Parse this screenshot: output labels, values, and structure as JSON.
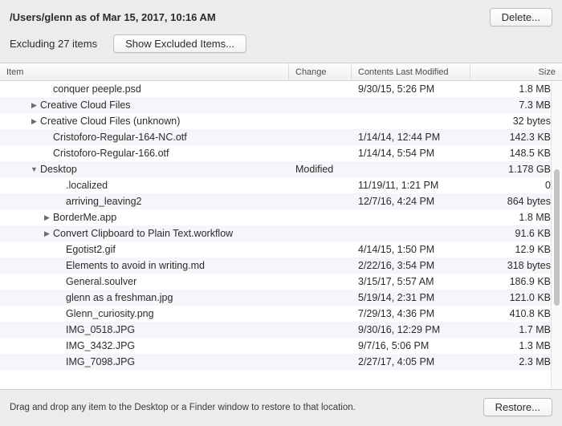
{
  "header": {
    "path_title": "/Users/glenn as of Mar 15, 2017, 10:16 AM",
    "delete_label": "Delete..."
  },
  "subheader": {
    "excluding_text": "Excluding 27 items",
    "show_excluded_label": "Show Excluded Items..."
  },
  "columns": {
    "item": "Item",
    "change": "Change",
    "modified": "Contents Last Modified",
    "size": "Size"
  },
  "rows": [
    {
      "indent": 2,
      "arrow": "",
      "name": "conquer peeple.psd",
      "change": "",
      "modified": "9/30/15, 5:26 PM",
      "size": "1.8 MB"
    },
    {
      "indent": 1,
      "arrow": "right",
      "name": "Creative Cloud Files",
      "change": "",
      "modified": "",
      "size": "7.3 MB"
    },
    {
      "indent": 1,
      "arrow": "right",
      "name": "Creative Cloud Files (unknown)",
      "change": "",
      "modified": "",
      "size": "32 bytes"
    },
    {
      "indent": 2,
      "arrow": "",
      "name": "Cristoforo-Regular-164-NC.otf",
      "change": "",
      "modified": "1/14/14, 12:44 PM",
      "size": "142.3 KB"
    },
    {
      "indent": 2,
      "arrow": "",
      "name": "Cristoforo-Regular-166.otf",
      "change": "",
      "modified": "1/14/14, 5:54 PM",
      "size": "148.5 KB"
    },
    {
      "indent": 1,
      "arrow": "down",
      "name": "Desktop",
      "change": "Modified",
      "modified": "",
      "size": "1.178 GB"
    },
    {
      "indent": 3,
      "arrow": "",
      "name": ".localized",
      "change": "",
      "modified": "11/19/11, 1:21 PM",
      "size": "0"
    },
    {
      "indent": 3,
      "arrow": "",
      "name": "arriving_leaving2",
      "change": "",
      "modified": "12/7/16, 4:24 PM",
      "size": "864 bytes"
    },
    {
      "indent": 2,
      "arrow": "right",
      "name": "BorderMe.app",
      "change": "",
      "modified": "",
      "size": "1.8 MB"
    },
    {
      "indent": 2,
      "arrow": "right",
      "name": "Convert Clipboard to Plain Text.workflow",
      "change": "",
      "modified": "",
      "size": "91.6 KB"
    },
    {
      "indent": 3,
      "arrow": "",
      "name": "Egotist2.gif",
      "change": "",
      "modified": "4/14/15, 1:50 PM",
      "size": "12.9 KB"
    },
    {
      "indent": 3,
      "arrow": "",
      "name": "Elements to avoid in writing.md",
      "change": "",
      "modified": "2/22/16, 3:54 PM",
      "size": "318 bytes"
    },
    {
      "indent": 3,
      "arrow": "",
      "name": "General.soulver",
      "change": "",
      "modified": "3/15/17, 5:57 AM",
      "size": "186.9 KB"
    },
    {
      "indent": 3,
      "arrow": "",
      "name": "glenn as a freshman.jpg",
      "change": "",
      "modified": "5/19/14, 2:31 PM",
      "size": "121.0 KB"
    },
    {
      "indent": 3,
      "arrow": "",
      "name": "Glenn_curiosity.png",
      "change": "",
      "modified": "7/29/13, 4:36 PM",
      "size": "410.8 KB"
    },
    {
      "indent": 3,
      "arrow": "",
      "name": "IMG_0518.JPG",
      "change": "",
      "modified": "9/30/16, 12:29 PM",
      "size": "1.7 MB"
    },
    {
      "indent": 3,
      "arrow": "",
      "name": "IMG_3432.JPG",
      "change": "",
      "modified": "9/7/16, 5:06 PM",
      "size": "1.3 MB"
    },
    {
      "indent": 3,
      "arrow": "",
      "name": "IMG_7098.JPG",
      "change": "",
      "modified": "2/27/17, 4:05 PM",
      "size": "2.3 MB"
    }
  ],
  "footer": {
    "hint": "Drag and drop any item to the Desktop or a Finder window to restore to that location.",
    "restore_label": "Restore..."
  }
}
